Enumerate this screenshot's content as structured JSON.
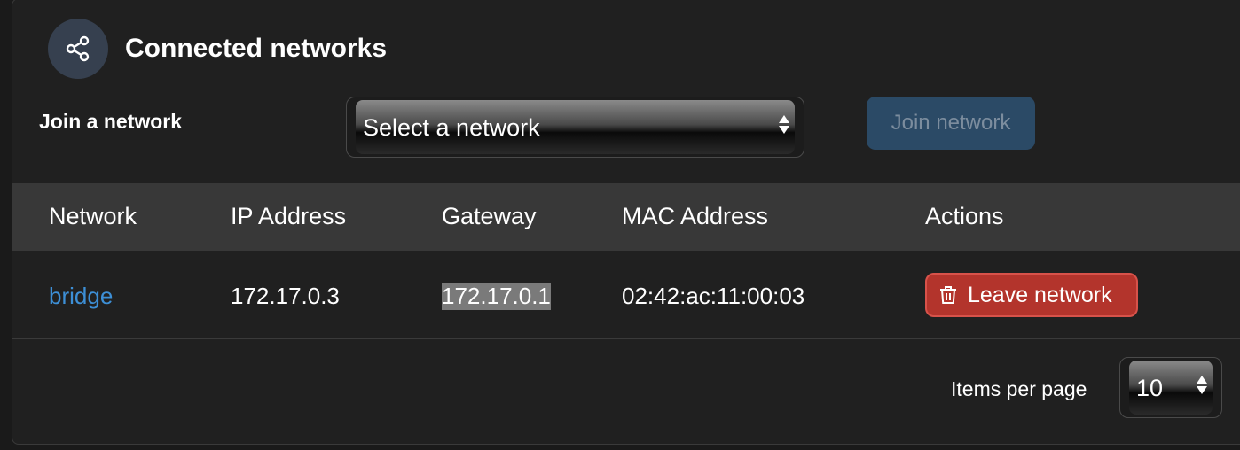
{
  "header": {
    "title": "Connected networks",
    "icon": "share-icon"
  },
  "join": {
    "label": "Join a network",
    "select_value": "Select a network",
    "button_label": "Join network"
  },
  "table": {
    "columns": [
      "Network",
      "IP Address",
      "Gateway",
      "MAC Address",
      "Actions"
    ],
    "rows": [
      {
        "network": "bridge",
        "ip": "172.17.0.3",
        "gateway": "172.17.0.1",
        "mac": "02:42:ac:11:00:03",
        "action_label": "Leave network"
      }
    ]
  },
  "pagination": {
    "items_per_page_label": "Items per page",
    "items_per_page_value": "10"
  },
  "colors": {
    "accent_link": "#3d8fd6",
    "danger": "#b3342c",
    "join_button_disabled": "#2b4a66",
    "header_icon_bg": "#36404f"
  }
}
